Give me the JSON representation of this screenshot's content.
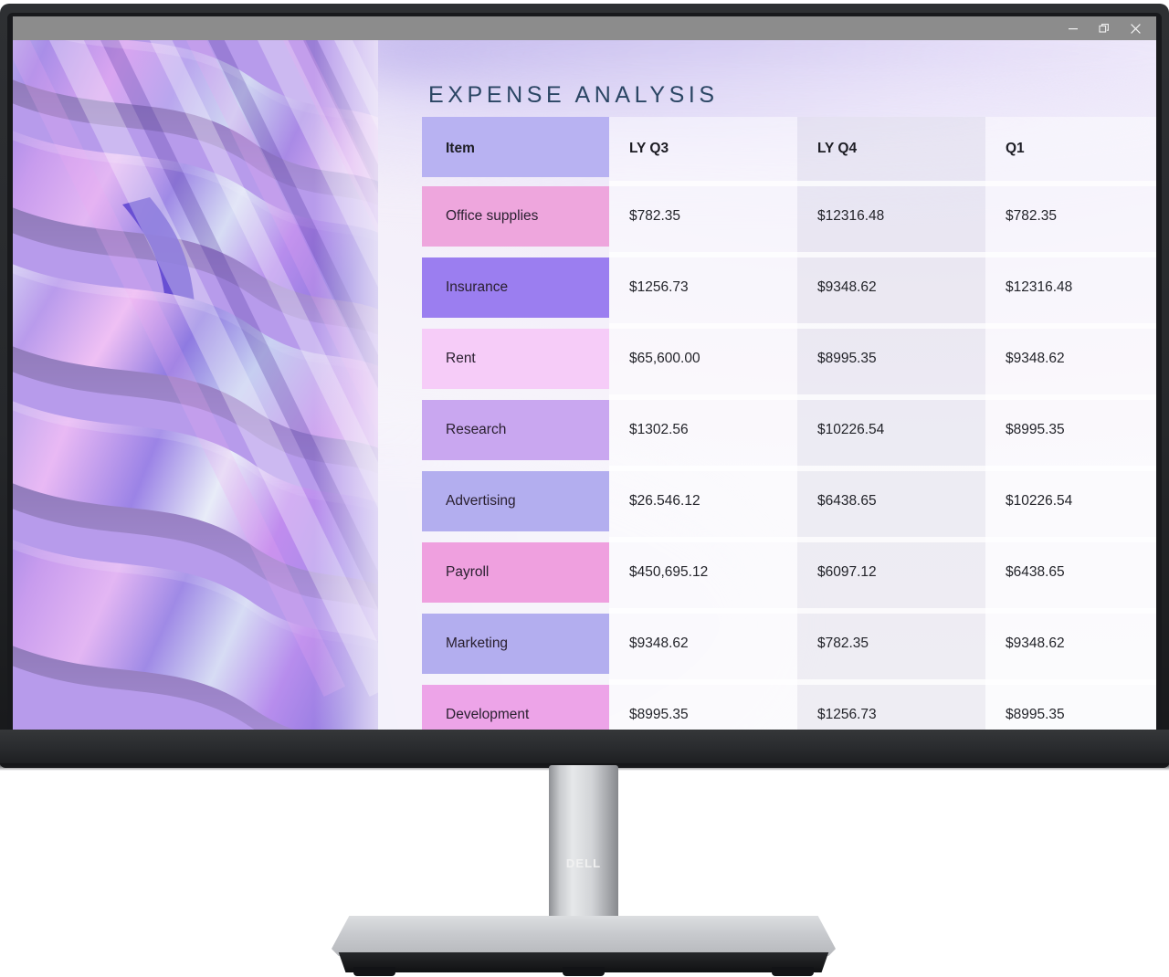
{
  "window": {
    "titlebar_color": "#8c8c8c",
    "controls": [
      {
        "name": "minimize",
        "glyph": "minimize-icon"
      },
      {
        "name": "restore",
        "glyph": "restore-icon"
      },
      {
        "name": "close",
        "glyph": "close-icon"
      }
    ]
  },
  "slide": {
    "title": "EXPENSE ANALYSIS",
    "title_color": "#2b4664",
    "background_color": "#f7f5fb"
  },
  "artwork": {
    "name": "abstract-3d-wave-ribbons",
    "palette": [
      "#8f7fe0",
      "#b48ef0",
      "#d49af2",
      "#e9a8f5",
      "#a8b6ee",
      "#cfd6f3",
      "#6a4fd8",
      "#e4e6f5"
    ]
  },
  "table": {
    "columns": [
      "Item",
      "LY Q3",
      "LY Q4",
      "Q1"
    ],
    "header_chip_color": "#b8b2f2",
    "rows": [
      {
        "item": "Office supplies",
        "chip": "#eea6dd",
        "values": [
          "$782.35",
          "$12316.48",
          "$782.35"
        ]
      },
      {
        "item": "Insurance",
        "chip": "#9b7ef0",
        "values": [
          "$1256.73",
          "$9348.62",
          "$12316.48"
        ]
      },
      {
        "item": "Rent",
        "chip": "#f6ccf8",
        "values": [
          "$65,600.00",
          "$8995.35",
          "$9348.62"
        ]
      },
      {
        "item": "Research",
        "chip": "#c9a7f0",
        "values": [
          "$1302.56",
          "$10226.54",
          "$8995.35"
        ]
      },
      {
        "item": "Advertising",
        "chip": "#b3aeef",
        "values": [
          "$26.546.12",
          "$6438.65",
          "$10226.54"
        ]
      },
      {
        "item": "Payroll",
        "chip": "#efa0df",
        "values": [
          "$450,695.12",
          "$6097.12",
          "$6438.65"
        ]
      },
      {
        "item": "Marketing",
        "chip": "#b3aeef",
        "values": [
          "$9348.62",
          "$782.35",
          "$9348.62"
        ]
      },
      {
        "item": "Development",
        "chip": "#eda4e8",
        "values": [
          "$8995.35",
          "$1256.73",
          "$8995.35"
        ]
      }
    ]
  },
  "monitor": {
    "brand": "DELL"
  }
}
